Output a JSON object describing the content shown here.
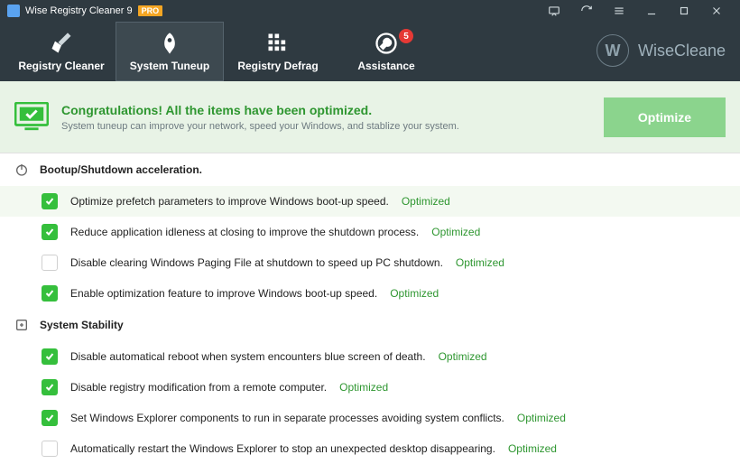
{
  "title": "Wise Registry Cleaner 9",
  "pro": "PRO",
  "brand": "WiseCleane",
  "toolbar": {
    "registry_cleaner": "Registry Cleaner",
    "system_tuneup": "System Tuneup",
    "registry_defrag": "Registry Defrag",
    "assistance": "Assistance",
    "assistance_badge": "5"
  },
  "banner": {
    "title": "Congratulations! All the items have been optimized.",
    "sub": "System tuneup can improve your network, speed your Windows, and stablize your system.",
    "button": "Optimize"
  },
  "sections": {
    "bootup": "Bootup/Shutdown acceleration.",
    "stability": "System Stability"
  },
  "rows": {
    "r1": {
      "text": "Optimize prefetch parameters to improve Windows boot-up speed.",
      "status": "Optimized"
    },
    "r2": {
      "text": "Reduce application idleness at closing to improve the shutdown process.",
      "status": "Optimized"
    },
    "r3": {
      "text": "Disable clearing Windows Paging File at shutdown to speed up PC shutdown.",
      "status": "Optimized"
    },
    "r4": {
      "text": "Enable optimization feature to improve Windows boot-up speed.",
      "status": "Optimized"
    },
    "r5": {
      "text": "Disable automatical reboot when system encounters blue screen of death.",
      "status": "Optimized"
    },
    "r6": {
      "text": "Disable registry modification from a remote computer.",
      "status": "Optimized"
    },
    "r7": {
      "text": "Set Windows Explorer components to run in separate processes avoiding system conflicts.",
      "status": "Optimized"
    },
    "r8": {
      "text": "Automatically restart the Windows Explorer to stop an unexpected desktop disappearing.",
      "status": "Optimized"
    }
  }
}
